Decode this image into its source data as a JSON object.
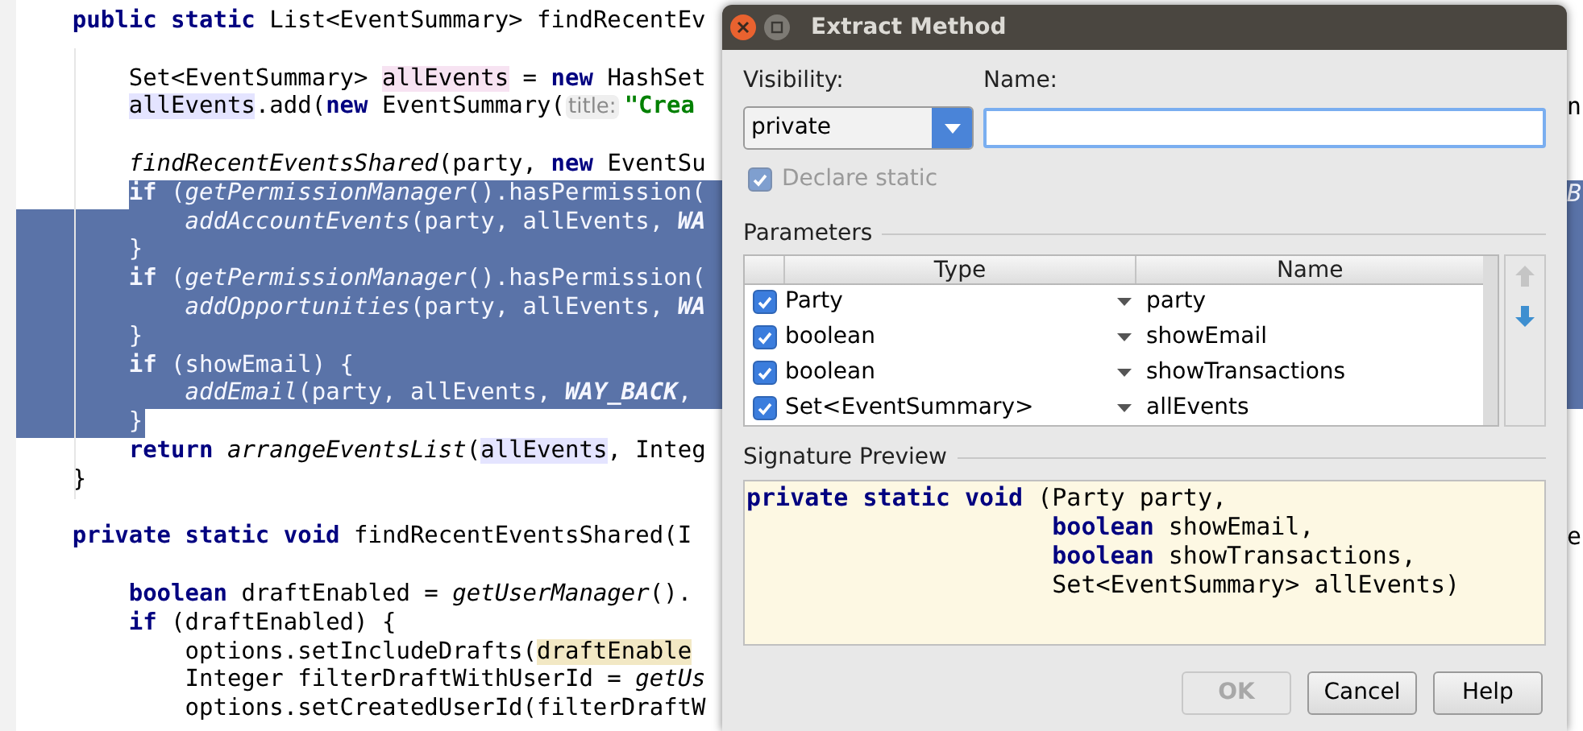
{
  "editor": {
    "lines": [
      {
        "kind": "code",
        "selected": false,
        "segments": [
          {
            "kind": "keyword",
            "text": "    public static"
          },
          {
            "kind": "plain",
            "text": " List<EventSummary> findRecentEv"
          }
        ]
      },
      {
        "kind": "blank"
      },
      {
        "kind": "code",
        "selected": false,
        "segments": [
          {
            "kind": "plain",
            "text": "        Set<EventSummary> "
          },
          {
            "kind": "declaration",
            "text": "allEvents"
          },
          {
            "kind": "plain",
            "text": " = "
          },
          {
            "kind": "keyword",
            "text": "new"
          },
          {
            "kind": "plain",
            "text": " HashSet"
          }
        ]
      },
      {
        "kind": "code",
        "selected": false,
        "tail": "n",
        "segments": [
          {
            "kind": "usage",
            "text": "        allEvents"
          },
          {
            "kind": "plain",
            "text": ".add("
          },
          {
            "kind": "keyword",
            "text": "new"
          },
          {
            "kind": "plain",
            "text": " EventSummary("
          },
          {
            "kind": "hint",
            "text": "title:"
          },
          {
            "kind": "string",
            "text": "\"Crea"
          }
        ]
      },
      {
        "kind": "blank"
      },
      {
        "kind": "code",
        "selected": false,
        "segments": [
          {
            "kind": "call",
            "text": "        findRecentEventsShared"
          },
          {
            "kind": "plain",
            "text": "(party, "
          },
          {
            "kind": "keyword",
            "text": "new"
          },
          {
            "kind": "plain",
            "text": " EventSu"
          }
        ]
      },
      {
        "kind": "code",
        "selected": true,
        "tail": "B",
        "segments": [
          {
            "kind": "keyword",
            "text": "        if"
          },
          {
            "kind": "plain",
            "text": " ("
          },
          {
            "kind": "call",
            "text": "getPermissionManager"
          },
          {
            "kind": "plain",
            "text": "().hasPermission("
          }
        ]
      },
      {
        "kind": "code",
        "selected": true,
        "segments": [
          {
            "kind": "call",
            "text": "            addAccountEvents"
          },
          {
            "kind": "plain",
            "text": "(party, allEvents, "
          },
          {
            "kind": "constant",
            "text": "WA"
          }
        ]
      },
      {
        "kind": "code",
        "selected": true,
        "segments": [
          {
            "kind": "plain",
            "text": "        }"
          }
        ]
      },
      {
        "kind": "code",
        "selected": true,
        "segments": [
          {
            "kind": "keyword",
            "text": "        if"
          },
          {
            "kind": "plain",
            "text": " ("
          },
          {
            "kind": "call",
            "text": "getPermissionManager"
          },
          {
            "kind": "plain",
            "text": "().hasPermission("
          }
        ]
      },
      {
        "kind": "code",
        "selected": true,
        "segments": [
          {
            "kind": "call",
            "text": "            addOpportunities"
          },
          {
            "kind": "plain",
            "text": "(party, allEvents, "
          },
          {
            "kind": "constant",
            "text": "WA"
          }
        ]
      },
      {
        "kind": "code",
        "selected": true,
        "segments": [
          {
            "kind": "plain",
            "text": "        }"
          }
        ]
      },
      {
        "kind": "code",
        "selected": true,
        "segments": [
          {
            "kind": "keyword",
            "text": "        if"
          },
          {
            "kind": "plain",
            "text": " (showEmail) {"
          }
        ]
      },
      {
        "kind": "code",
        "selected": true,
        "segments": [
          {
            "kind": "call",
            "text": "            addEmail"
          },
          {
            "kind": "plain",
            "text": "(party, allEvents, "
          },
          {
            "kind": "constant",
            "text": "WAY_BACK"
          },
          {
            "kind": "plain",
            "text": ","
          }
        ]
      },
      {
        "kind": "code",
        "selected": true,
        "segments": [
          {
            "kind": "plain",
            "text": "        }"
          }
        ]
      },
      {
        "kind": "code",
        "selected": false,
        "segments": [
          {
            "kind": "keyword",
            "text": "        return"
          },
          {
            "kind": "call",
            "text": " arrangeEventsList"
          },
          {
            "kind": "plain",
            "text": "("
          },
          {
            "kind": "usage",
            "text": "allEvents"
          },
          {
            "kind": "plain",
            "text": ", Integ"
          }
        ]
      },
      {
        "kind": "code",
        "selected": false,
        "segments": [
          {
            "kind": "plain",
            "text": "    }"
          }
        ]
      },
      {
        "kind": "blank"
      },
      {
        "kind": "code",
        "selected": false,
        "tail": "e",
        "segments": [
          {
            "kind": "keyword",
            "text": "    private static void"
          },
          {
            "kind": "plain",
            "text": " findRecentEventsShared(I"
          }
        ]
      },
      {
        "kind": "blank"
      },
      {
        "kind": "code",
        "selected": false,
        "segments": [
          {
            "kind": "keyword",
            "text": "        boolean"
          },
          {
            "kind": "plain",
            "text": " draftEnabled = "
          },
          {
            "kind": "call",
            "text": "getUserManager"
          },
          {
            "kind": "plain",
            "text": "()."
          }
        ]
      },
      {
        "kind": "code",
        "selected": false,
        "segments": [
          {
            "kind": "keyword",
            "text": "        if"
          },
          {
            "kind": "plain",
            "text": " (draftEnabled) {"
          }
        ]
      },
      {
        "kind": "code",
        "selected": false,
        "segments": [
          {
            "kind": "plain",
            "text": "            options.setIncludeDrafts("
          },
          {
            "kind": "read",
            "text": "draftEnable"
          }
        ]
      },
      {
        "kind": "code",
        "selected": false,
        "segments": [
          {
            "kind": "plain",
            "text": "            Integer filterDraftWithUserId = "
          },
          {
            "kind": "call",
            "text": "getUs"
          }
        ]
      },
      {
        "kind": "code",
        "selected": false,
        "segments": [
          {
            "kind": "plain",
            "text": "            options.setCreatedUserId(filterDraftW"
          }
        ]
      }
    ]
  },
  "dialog": {
    "title": "Extract Method",
    "visibility": {
      "label": "Visibility:",
      "value": "private"
    },
    "name": {
      "label": "Name:"
    },
    "declare_static": {
      "label": "Declare static",
      "checked": true,
      "disabled": true
    },
    "parameters": {
      "label": "Parameters",
      "columns": [
        "Type",
        "Name"
      ],
      "rows": [
        {
          "checked": true,
          "type": "Party",
          "name": "party"
        },
        {
          "checked": true,
          "type": "boolean",
          "name": "showEmail"
        },
        {
          "checked": true,
          "type": "boolean",
          "name": "showTransactions"
        },
        {
          "checked": true,
          "type": "Set<EventSummary>",
          "name": "allEvents"
        }
      ],
      "move_up_disabled": true,
      "move_down_disabled": false
    },
    "signature_preview": {
      "label": "Signature Preview",
      "lines": [
        [
          {
            "kind": "keyword",
            "text": "private static void"
          },
          {
            "kind": "plain",
            "text": " (Party party,"
          }
        ],
        [
          {
            "kind": "keyword",
            "text": "                     boolean"
          },
          {
            "kind": "plain",
            "text": " showEmail,"
          }
        ],
        [
          {
            "kind": "keyword",
            "text": "                     boolean"
          },
          {
            "kind": "plain",
            "text": " showTransactions,"
          }
        ],
        [
          {
            "kind": "plain",
            "text": "                     Set<EventSummary> allEvents)"
          }
        ]
      ]
    },
    "buttons": [
      {
        "label": "OK",
        "disabled": true
      },
      {
        "label": "Cancel",
        "disabled": false
      },
      {
        "label": "Help",
        "disabled": false
      }
    ]
  }
}
